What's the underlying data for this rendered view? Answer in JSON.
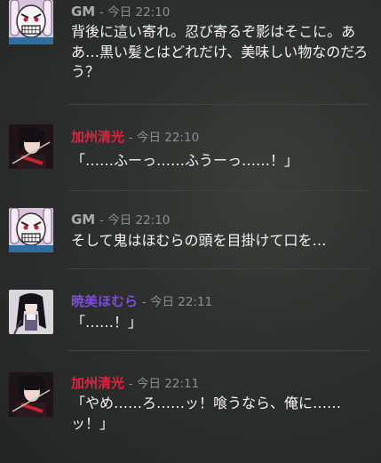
{
  "colors": {
    "gm": "#a7aaa8",
    "kashuu": "#e0213f",
    "homura": "#7c4fd6",
    "meta": "#8c8f8d"
  },
  "messages": [
    {
      "author": "GM",
      "time": "- 今日 22:10",
      "text": "背後に這い寄れ。忍び寄るぞ影はそこに。ああ…黒い髪とはどれだけ、美味しい物なのだろう？",
      "avatar": "rabbit-mask-avatar"
    },
    {
      "author": "加州清光",
      "time": "- 今日 22:10",
      "text": "「……ふーっ……ふうーっ……！」",
      "avatar": "kashuu-avatar"
    },
    {
      "author": "GM",
      "time": "- 今日 22:10",
      "text": "そして鬼はほむらの頭を目掛けて口を…",
      "avatar": "rabbit-mask-avatar"
    },
    {
      "author": "暁美ほむら",
      "time": "- 今日 22:11",
      "text": "「……！」",
      "avatar": "homura-avatar"
    },
    {
      "author": "加州清光",
      "time": "- 今日 22:11",
      "text": "「やめ……ろ……ッ！喰うなら、俺に……ッ！」",
      "avatar": "kashuu-avatar"
    }
  ]
}
